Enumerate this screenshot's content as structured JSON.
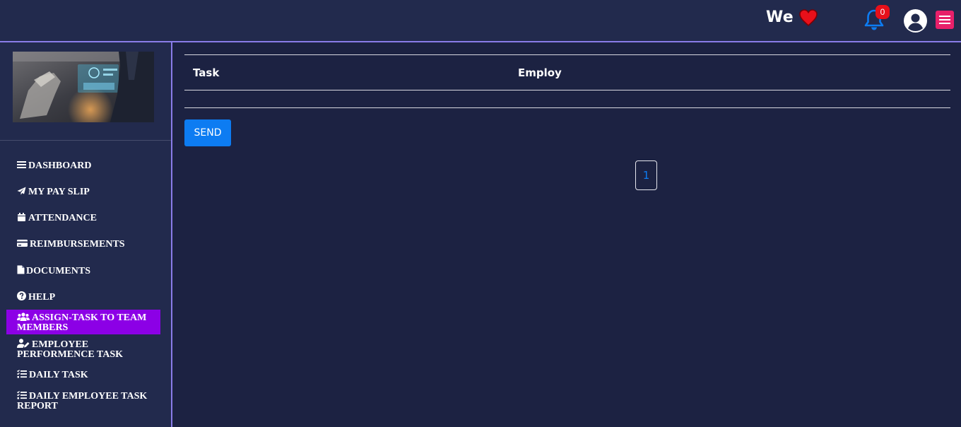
{
  "header": {
    "brand_text": "We",
    "notifications_count": "0",
    "colors": {
      "bg": "#222a4d",
      "accent_line": "#8a7ce8",
      "heart": "#e8101a",
      "bell": "#0d7cf2",
      "menu": "#e8206a"
    }
  },
  "sidebar": {
    "items": [
      {
        "label": "DASHBOARD",
        "icon": "bars-icon"
      },
      {
        "label": "MY PAY SLIP",
        "icon": "paper-plane-icon"
      },
      {
        "label": "ATTENDANCE",
        "icon": "calendar-icon"
      },
      {
        "label": "REIMBURSEMENTS",
        "icon": "credit-card-icon"
      },
      {
        "label": "DOCUMENTS",
        "icon": "file-icon"
      },
      {
        "label": "HELP",
        "icon": "question-circle-icon"
      },
      {
        "label": "ASSIGN-TASK TO TEAM MEMBERS",
        "icon": "users-icon",
        "active": true
      },
      {
        "label": "EMPLOYEE PERFORMENCE TASK",
        "icon": "user-edit-icon"
      },
      {
        "label": "DAILY TASK",
        "icon": "tasks-icon"
      },
      {
        "label": "DAILY EMPLOYEE TASK REPORT",
        "icon": "tasks-icon"
      }
    ],
    "active_color": "#8c00e6"
  },
  "main": {
    "table": {
      "headers": [
        "Task",
        "Employ"
      ],
      "rows": []
    },
    "send_label": "SEND",
    "pagination": {
      "current": "1"
    }
  }
}
